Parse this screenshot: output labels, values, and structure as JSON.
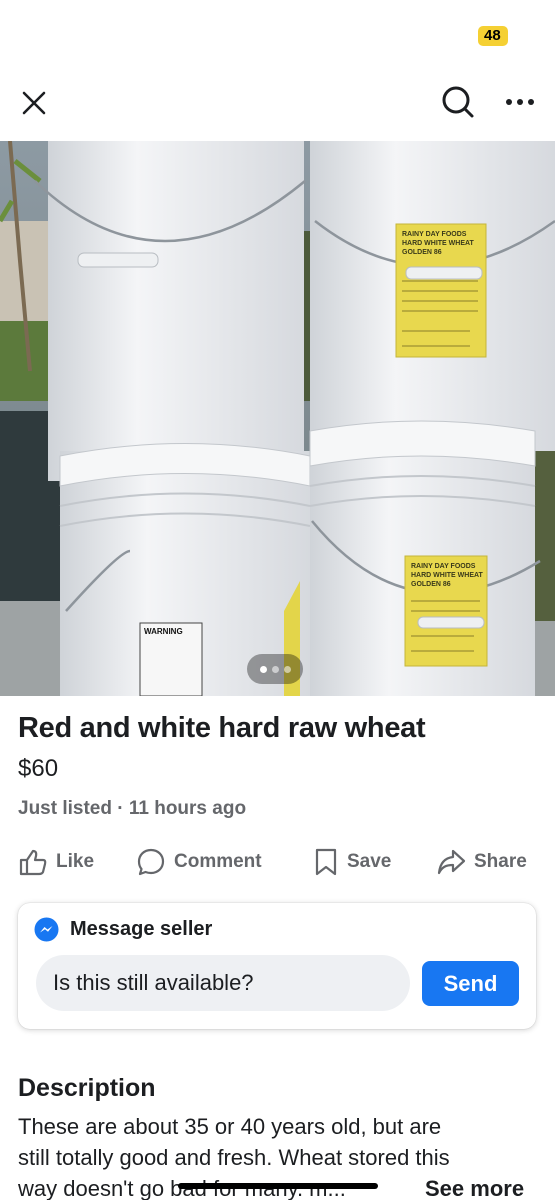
{
  "status": {
    "notification_count": "48"
  },
  "nav": {
    "close_icon": "close-icon",
    "search_icon": "search-icon",
    "more_icon": "more-horizontal-icon"
  },
  "photo": {
    "label_front": [
      "RAINY DAY FOODS",
      "HARD WHITE WHEAT",
      "GOLDEN 86"
    ],
    "warning_label": "WARNING",
    "carousel": {
      "total": 3,
      "active": 1
    }
  },
  "listing": {
    "title": "Red and white hard raw wheat",
    "price": "$60",
    "listed": "Just listed · 11 hours ago"
  },
  "actions": {
    "like": "Like",
    "comment": "Comment",
    "save": "Save",
    "share": "Share"
  },
  "message": {
    "header": "Message seller",
    "input_value": "Is this still available?",
    "send_label": "Send"
  },
  "description": {
    "heading": "Description",
    "lines": [
      "These are about 35 or 40 years old, but are",
      "still totally good and fresh. Wheat stored this",
      "way doesn't go bad for many. m..."
    ],
    "see_more": "See more"
  },
  "colors": {
    "accent": "#1877f2",
    "badge": "#f5d033",
    "secondary_text": "#65676b"
  }
}
